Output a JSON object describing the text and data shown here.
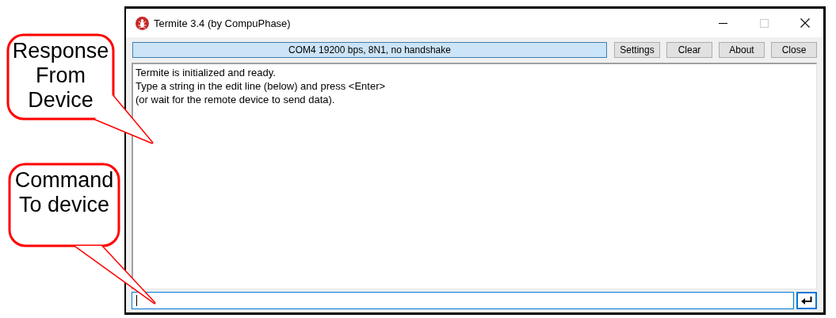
{
  "window": {
    "title": "Termite 3.4 (by CompuPhase)"
  },
  "toolbar": {
    "status": "COM4 19200 bps, 8N1, no handshake",
    "buttons": [
      "Settings",
      "Clear",
      "About",
      "Close"
    ]
  },
  "output": {
    "lines": [
      "Termite is initialized and ready.",
      "Type a string in the edit line (below) and press <Enter>",
      "(or wait for the remote device to send data)."
    ]
  },
  "input": {
    "focused": true
  },
  "callouts": [
    {
      "text": "Response From Device"
    },
    {
      "text": "Command To device"
    }
  ]
}
